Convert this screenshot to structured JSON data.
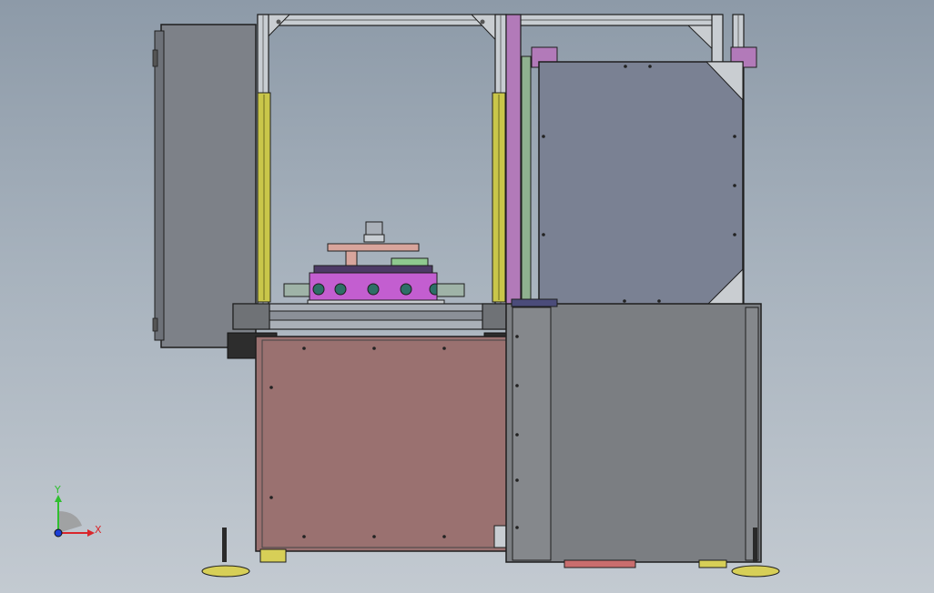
{
  "triad": {
    "y_label": "Y",
    "x_label": "X",
    "y_color": "#2fbf2f",
    "x_color": "#d9262b",
    "z_color": "#1b3fd6"
  },
  "colors": {
    "background_top": "#8d9aa8",
    "background_bottom": "#c3cad1",
    "frame": "#c8cdd2",
    "frame_magenta": "#b27ab9",
    "left_cabinet": "#7d8188",
    "right_panel": "#7a8193",
    "lower_base": "#9a7170",
    "right_lower_cabinet": "#7b7e82",
    "gas_spring": "#c9c64a",
    "rotary_table": "#c35ed0",
    "foot_pad": "#d7cf57"
  }
}
